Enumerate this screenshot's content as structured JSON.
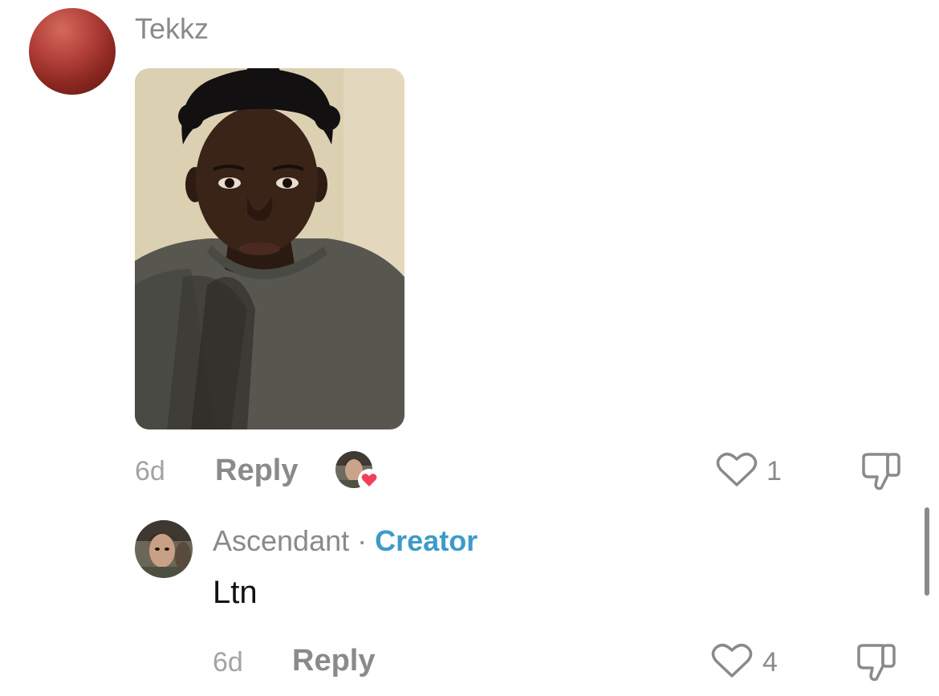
{
  "comment": {
    "username": "Tekkz",
    "time": "6d",
    "reply_label": "Reply",
    "like_count": "1",
    "avatar_icon": "profile-avatar",
    "liked_by_creator_icon": "creator-heart-badge"
  },
  "reply_comment": {
    "username": "Ascendant",
    "separator": "·",
    "badge": "Creator",
    "text": "Ltn",
    "time": "6d",
    "reply_label": "Reply",
    "like_count": "4"
  },
  "colors": {
    "creator_accent": "#3d9bc8",
    "heart_badge": "#f2405a",
    "muted_text": "#8a8a8a"
  },
  "icons": {
    "like": "heart-outline-icon",
    "dislike": "thumbs-down-icon"
  }
}
